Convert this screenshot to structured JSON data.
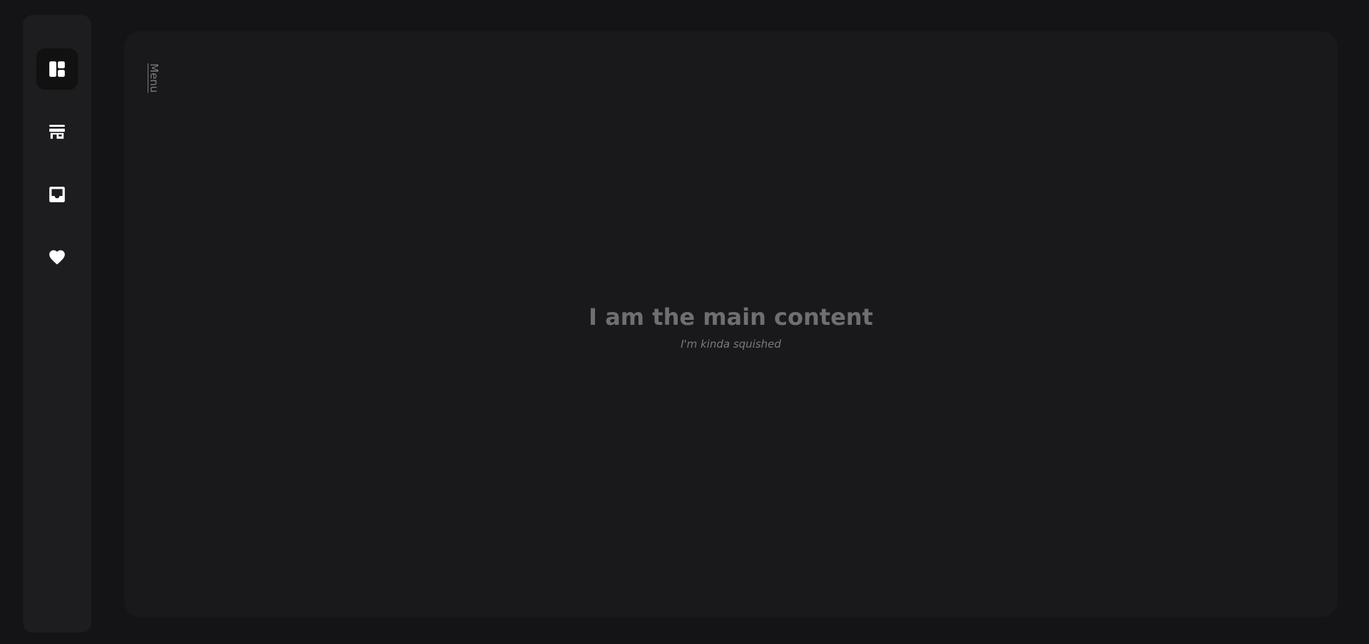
{
  "sidebar": {
    "items": [
      {
        "icon": "dashboard-icon",
        "active": true
      },
      {
        "icon": "store-icon",
        "active": false
      },
      {
        "icon": "inbox-icon",
        "active": false
      },
      {
        "icon": "heart-icon",
        "active": false
      }
    ]
  },
  "main": {
    "menu_label": "Menu",
    "title": "I am the main content",
    "subtitle": "I'm kinda squished"
  },
  "colors": {
    "page_background": "#141416",
    "sidebar_background": "#1d1d20",
    "main_background": "#19191b",
    "icon": "#ffffff",
    "text_muted": "#6f6f73"
  }
}
